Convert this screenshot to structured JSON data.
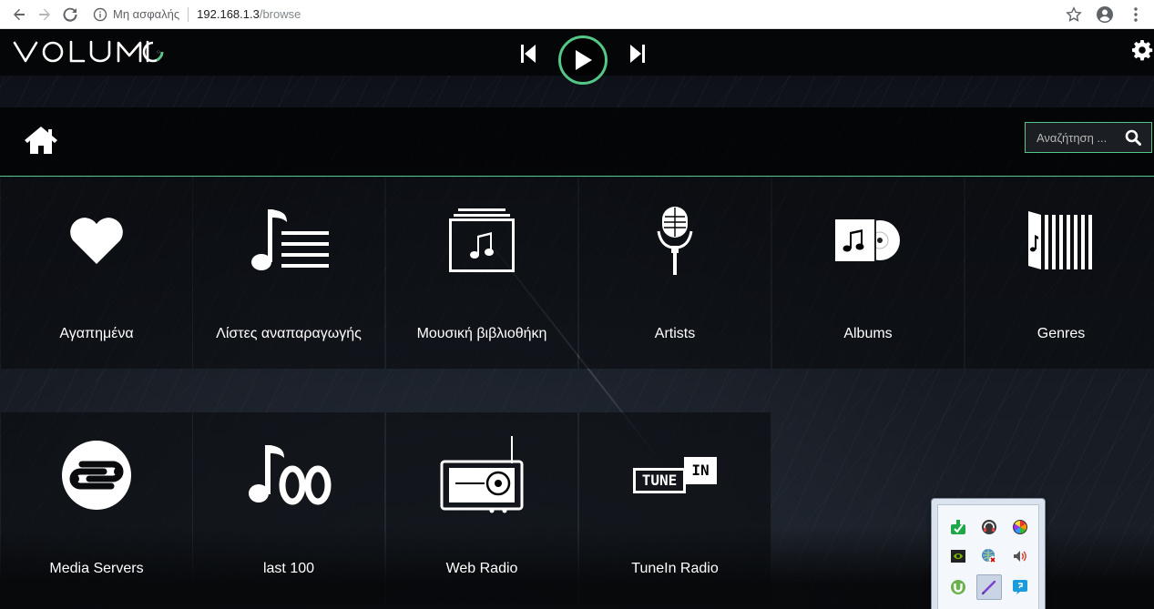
{
  "browser": {
    "security_label": "Μη ασφαλής",
    "url_host": "192.168.1.3",
    "url_path": "/browse"
  },
  "app": {
    "logo_text": "VOLUMIO",
    "accent_color": "#54c688",
    "search_placeholder": "Αναζήτηση ..."
  },
  "tiles": [
    {
      "label": "Αγαπημένα",
      "icon": "heart-icon"
    },
    {
      "label": "Λίστες αναπαραγωγής",
      "icon": "playlist-icon"
    },
    {
      "label": "Μουσική βιβλιοθήκη",
      "icon": "music-library-icon"
    },
    {
      "label": "Artists",
      "icon": "microphone-icon"
    },
    {
      "label": "Albums",
      "icon": "album-icon"
    },
    {
      "label": "Genres",
      "icon": "genres-icon"
    },
    {
      "label": "Media Servers",
      "icon": "media-servers-icon"
    },
    {
      "label": "last 100",
      "icon": "last-100-icon"
    },
    {
      "label": "Web Radio",
      "icon": "radio-icon"
    },
    {
      "label": "TuneIn Radio",
      "icon": "tunein-icon"
    }
  ],
  "tunein_logo": {
    "tune": "TUNE",
    "in": "IN"
  },
  "tray_icons": [
    "green-download-icon",
    "headset-icon",
    "color-wheel-icon",
    "nvidia-icon",
    "network-icon",
    "speaker-icon",
    "utorrent-icon",
    "pen-icon",
    "chat-icon"
  ]
}
